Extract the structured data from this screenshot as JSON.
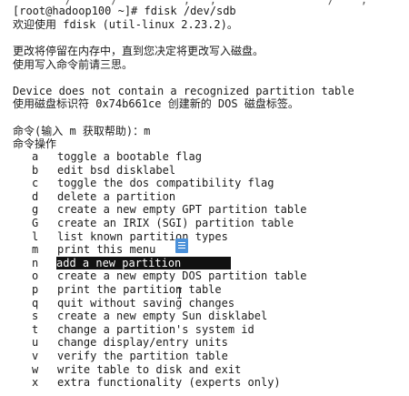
{
  "terminal": {
    "clipped_top_line": "        /      /          ,   ,                 /    ,        ",
    "prompt_line": "[root@hadoop100 ~]# fdisk /dev/sdb",
    "welcome_line": "欢迎使用 fdisk (util-linux 2.23.2)。",
    "notice_line_1": "更改将停留在内存中，直到您决定将更改写入磁盘。",
    "notice_line_2": "使用写入命令前请三思。",
    "no_table_line": "Device does not contain a recognized partition table",
    "new_label_line": "使用磁盘标识符 0x74b661ce 创建新的 DOS 磁盘标签。",
    "command_prompt": "命令(输入 m 获取帮助)：m",
    "actions_header": "命令操作"
  },
  "menu": [
    {
      "key": "a",
      "desc": "toggle a bootable flag"
    },
    {
      "key": "b",
      "desc": "edit bsd disklabel"
    },
    {
      "key": "c",
      "desc": "toggle the dos compatibility flag"
    },
    {
      "key": "d",
      "desc": "delete a partition"
    },
    {
      "key": "g",
      "desc": "create a new empty GPT partition table"
    },
    {
      "key": "G",
      "desc": "create an IRIX (SGI) partition table"
    },
    {
      "key": "l",
      "desc": "list known partition types"
    },
    {
      "key": "m",
      "desc": "print this menu"
    },
    {
      "key": "n",
      "desc": "add a new partition"
    },
    {
      "key": "o",
      "desc": "create a new empty DOS partition table"
    },
    {
      "key": "p",
      "desc": "print the partition table"
    },
    {
      "key": "q",
      "desc": "quit without saving changes"
    },
    {
      "key": "s",
      "desc": "create a new empty Sun disklabel"
    },
    {
      "key": "t",
      "desc": "change a partition's system id"
    },
    {
      "key": "u",
      "desc": "change display/entry units"
    },
    {
      "key": "v",
      "desc": "verify the partition table"
    },
    {
      "key": "w",
      "desc": "write table to disk and exit"
    },
    {
      "key": "x",
      "desc": "extra functionality (experts only)"
    }
  ],
  "selected_key": "n",
  "icons": {
    "overlay": "document-icon",
    "pointer": "text-cursor-icon"
  },
  "colors": {
    "background": "#ffffff",
    "text": "#1a1a1a",
    "highlight_bg": "#111111",
    "highlight_text": "#ffffff",
    "overlay_icon": "#4a90d9"
  }
}
